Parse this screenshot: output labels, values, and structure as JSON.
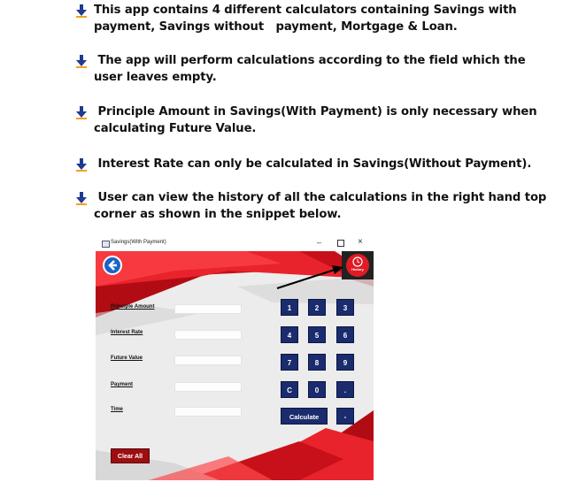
{
  "bullets": [
    {
      "line1": "This app contains 4 different calculators containing Savings with",
      "line2": "payment, Savings without   payment, Mortgage & Loan."
    },
    {
      "line1": " The app will perform calculations according to the field which the",
      "line2": "user leaves empty."
    },
    {
      "line1": " Principle Amount in Savings(With Payment) is only necessary when",
      "line2": "calculating Future Value."
    },
    {
      "line1": " Interest Rate can only be calculated in Savings(Without Payment).",
      "line2": ""
    },
    {
      "line1": " User can view the history of all the calculations in the right hand top",
      "line2": "corner as shown in the snippet below."
    }
  ],
  "app": {
    "window_title": "Savings(With Payment)",
    "minimize_glyph": "–",
    "close_glyph": "×",
    "history_label": "History",
    "fields": [
      {
        "label": "Principle Amount",
        "value": ""
      },
      {
        "label": "Interest Rate",
        "value": ""
      },
      {
        "label": "Future Value",
        "value": ""
      },
      {
        "label": "Payment",
        "value": ""
      },
      {
        "label": "Time",
        "value": ""
      }
    ],
    "keypad": [
      "1",
      "2",
      "3",
      "4",
      "5",
      "6",
      "7",
      "8",
      "9",
      "C",
      "0",
      ".",
      "-"
    ],
    "calculate_label": "Calculate",
    "clear_label": "Clear All"
  },
  "colors": {
    "accent_red": "#e01b24",
    "dark_red": "#9c0e12",
    "navy": "#1a2c6e",
    "back_blue": "#1b63c6"
  }
}
